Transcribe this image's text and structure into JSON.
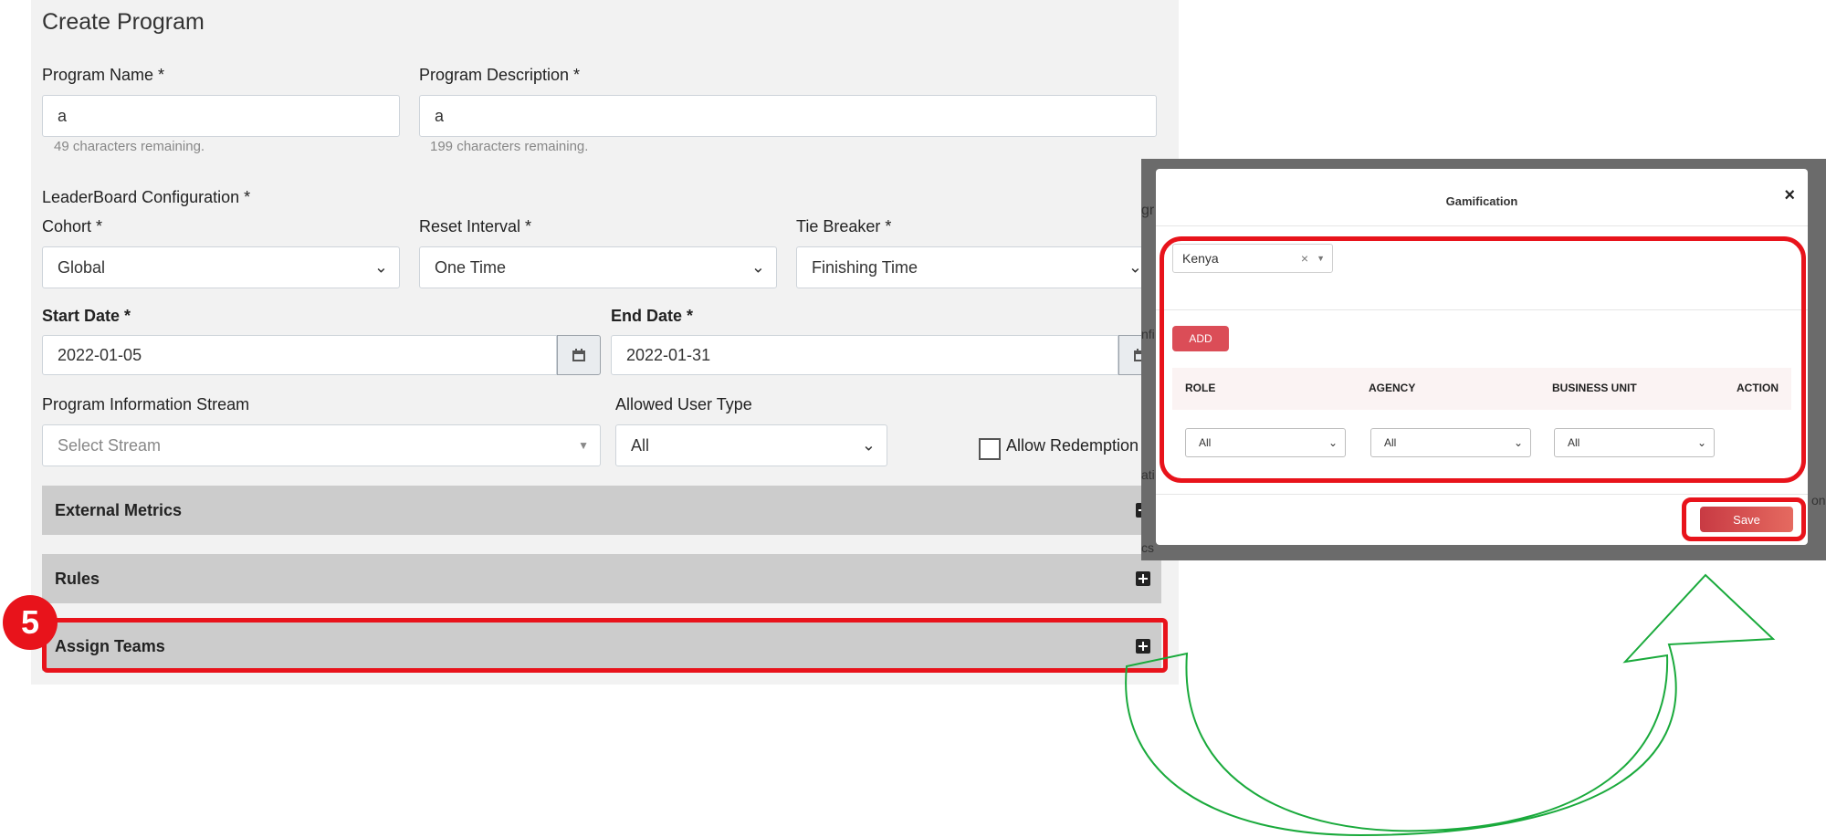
{
  "page": {
    "title": "Create Program"
  },
  "form": {
    "program_name": {
      "label": "Program Name *",
      "value": "a",
      "hint": "49 characters remaining."
    },
    "program_description": {
      "label": "Program Description *",
      "value": "a",
      "hint": "199 characters remaining."
    },
    "leaderboard_label": "LeaderBoard Configuration *",
    "cohort": {
      "label": "Cohort *",
      "value": "Global"
    },
    "reset_interval": {
      "label": "Reset Interval *",
      "value": "One Time"
    },
    "tie_breaker": {
      "label": "Tie Breaker *",
      "value": "Finishing Time"
    },
    "start_date": {
      "label": "Start Date *",
      "value": "2022-01-05"
    },
    "end_date": {
      "label": "End Date *",
      "value": "2022-01-31"
    },
    "info_stream": {
      "label": "Program Information Stream",
      "placeholder": "Select Stream"
    },
    "allowed_user_type": {
      "label": "Allowed User Type",
      "value": "All"
    },
    "allow_redemption": {
      "label": "Allow Redemption",
      "checked": false
    }
  },
  "sections": [
    {
      "label": "External Metrics"
    },
    {
      "label": "Rules"
    },
    {
      "label": "Assign Teams"
    }
  ],
  "annotation": {
    "step": "5",
    "highlight_color": "#e8131b",
    "arrow_color": "#1aaa3c"
  },
  "modal": {
    "title": "Gamification",
    "close": "×",
    "selected_tag": "Kenya",
    "tag_clear": "×",
    "add_label": "ADD",
    "columns": [
      "ROLE",
      "AGENCY",
      "BUSINESS UNIT",
      "ACTION"
    ],
    "row": {
      "role": "All",
      "agency": "All",
      "business_unit": "All"
    },
    "save_label": "Save"
  },
  "colors": {
    "accent": "#db4d57",
    "panel": "#f2f2f2",
    "accordion": "#cccccc"
  }
}
